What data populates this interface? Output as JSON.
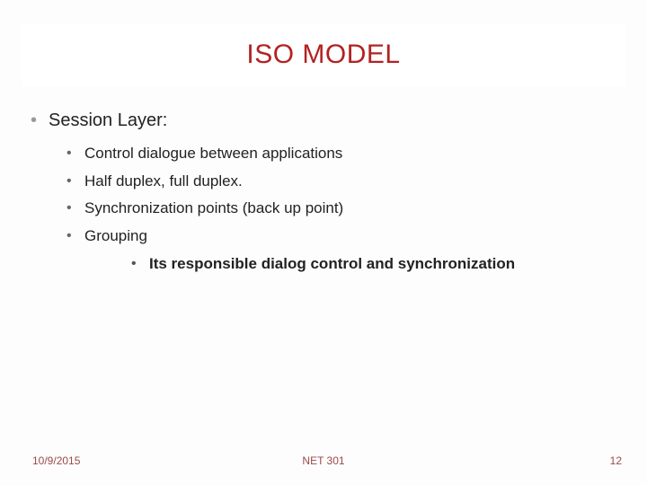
{
  "title": "ISO MODEL",
  "main_item": "Session Layer:",
  "sub_items": [
    "Control dialogue  between applications",
    "Half duplex, full duplex.",
    "Synchronization points (back up point)",
    "Grouping"
  ],
  "sub_sub_item": "Its responsible dialog control and synchronization",
  "footer": {
    "date": "10/9/2015",
    "course": "NET 301",
    "page": "12"
  }
}
